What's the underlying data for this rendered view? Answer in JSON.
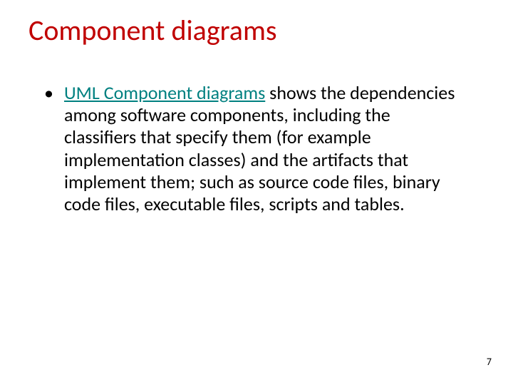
{
  "slide": {
    "title": "Component diagrams",
    "bullet": {
      "link_text": "UML Component diagrams",
      "rest_text": " shows the dependencies among software components, including the classifiers that specify them (for example implementation classes) and the artifacts that implement them; such as source code files, binary code files, executable files, scripts and tables."
    },
    "page_number": "7"
  }
}
